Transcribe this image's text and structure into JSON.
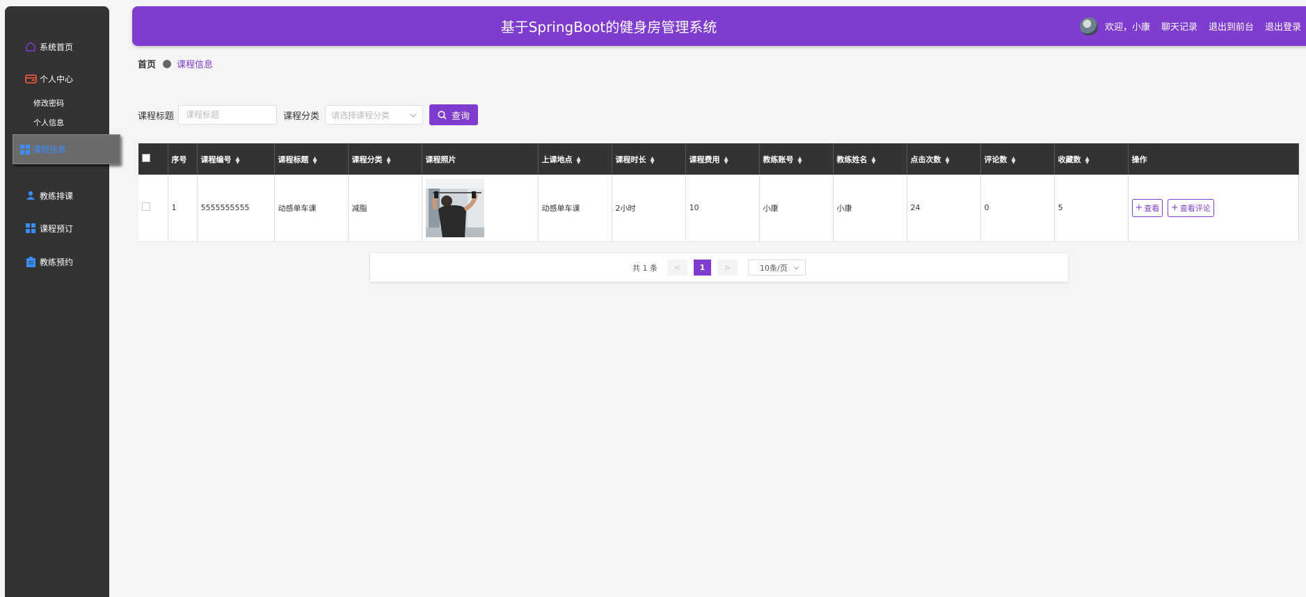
{
  "sidebar": {
    "items": [
      {
        "label": "系统首页",
        "icon": "home-icon",
        "color": "#7f3ccf"
      },
      {
        "label": "个人中心",
        "icon": "wallet-icon",
        "color": "#ff5a3c"
      },
      {
        "label": "课程信息",
        "icon": "grid-icon",
        "color": "#3a8cff"
      },
      {
        "label": "教练排课",
        "icon": "user-icon",
        "color": "#3a8cff"
      },
      {
        "label": "课程预订",
        "icon": "grid-icon",
        "color": "#3a8cff"
      },
      {
        "label": "教练预约",
        "icon": "clipboard-icon",
        "color": "#3a8cff"
      }
    ],
    "sub_items": [
      "修改密码",
      "个人信息"
    ]
  },
  "header": {
    "title": "基于SpringBoot的健身房管理系统",
    "welcome": "欢迎，小康",
    "links": [
      "聊天记录",
      "退出到前台",
      "退出登录"
    ]
  },
  "breadcrumb": {
    "home": "首页",
    "current": "课程信息"
  },
  "search": {
    "title_label": "课程标题",
    "title_placeholder": "课程标题",
    "category_label": "课程分类",
    "category_placeholder": "请选择课程分类",
    "query_label": "查询"
  },
  "table": {
    "columns": [
      "序号",
      "课程编号",
      "课程标题",
      "课程分类",
      "课程照片",
      "上课地点",
      "课程时长",
      "课程费用",
      "教练账号",
      "教练姓名",
      "点击次数",
      "评论数",
      "收藏数",
      "操作"
    ],
    "rows": [
      {
        "index": "1",
        "code": "5555555555",
        "title": "动感单车课",
        "category": "减脂",
        "location": "动感单车课",
        "duration": "2小时",
        "fee": "10",
        "coach_account": "小康",
        "coach_name": "小康",
        "clicks": "24",
        "comments": "0",
        "favorites": "5"
      }
    ],
    "actions": {
      "view": "查看",
      "view_comments": "查看评论"
    }
  },
  "pagination": {
    "total": "共 1 条",
    "prev": "<",
    "current": "1",
    "next": ">",
    "page_size": "10条/页"
  }
}
